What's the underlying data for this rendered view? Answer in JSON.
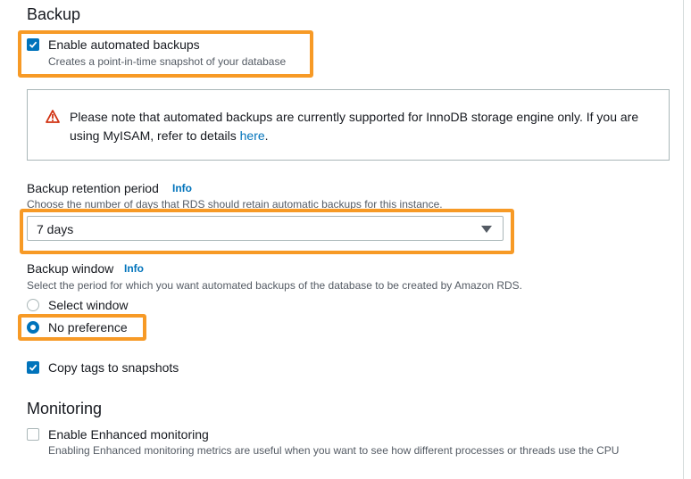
{
  "backup": {
    "heading": "Backup",
    "enable_label": "Enable automated backups",
    "enable_desc": "Creates a point-in-time snapshot of your database",
    "enable_checked": true,
    "alert_text_before": "Please note that automated backups are currently supported for InnoDB storage engine only. If you are using MyISAM, refer to details ",
    "alert_link": "here",
    "alert_text_after": ".",
    "retention_label": "Backup retention period",
    "retention_info": "Info",
    "retention_desc": "Choose the number of days that RDS should retain automatic backups for this instance.",
    "retention_value": "7 days",
    "window_label": "Backup window",
    "window_info": "Info",
    "window_desc": "Select the period for which you want automated backups of the database to be created by Amazon RDS.",
    "window_options": [
      "Select window",
      "No preference"
    ],
    "window_selected": "No preference",
    "copy_tags_label": "Copy tags to snapshots",
    "copy_tags_checked": true
  },
  "monitoring": {
    "heading": "Monitoring",
    "enhanced_label": "Enable Enhanced monitoring",
    "enhanced_desc": "Enabling Enhanced monitoring metrics are useful when you want to see how different processes or threads use the CPU",
    "enhanced_checked": false
  },
  "colors": {
    "accent": "#0073bb",
    "highlight": "#f79a26",
    "warning": "#d13212"
  }
}
